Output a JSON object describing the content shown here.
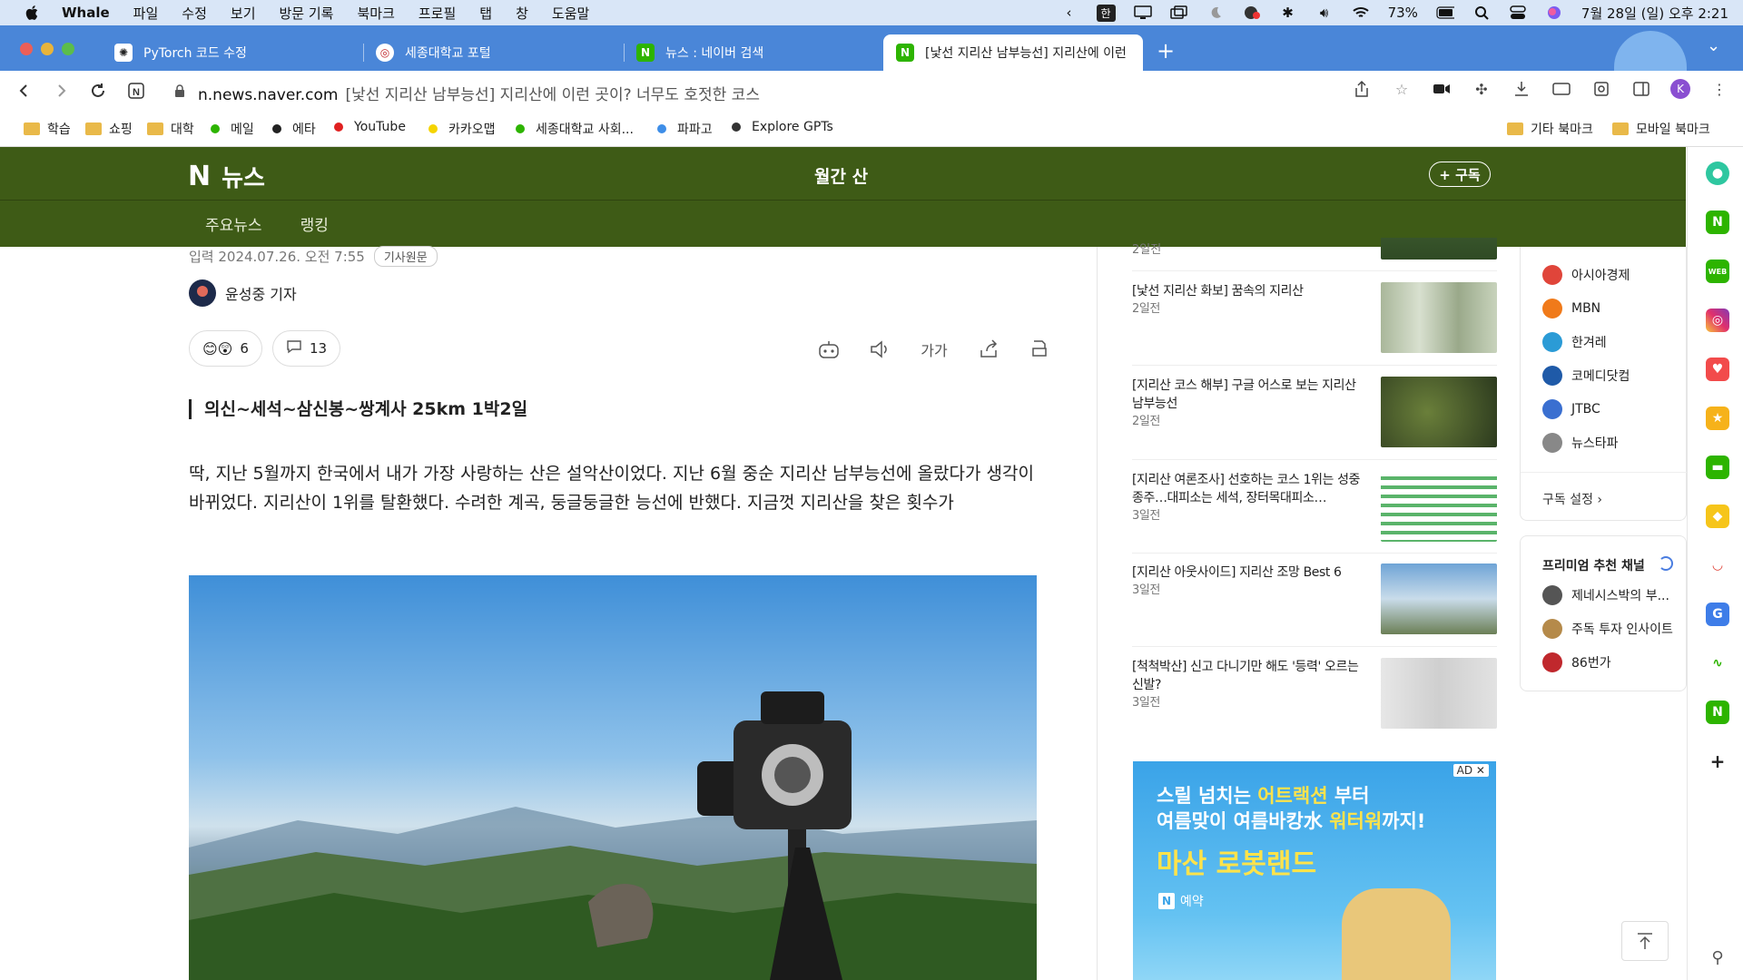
{
  "menubar": {
    "app_name": "Whale",
    "items": [
      "파일",
      "수정",
      "보기",
      "방문 기록",
      "북마크",
      "프로필",
      "탭",
      "창",
      "도움말"
    ],
    "ime": "한",
    "battery": "73%",
    "datetime": "7월 28일 (일) 오후 2:21"
  },
  "tabs": [
    {
      "label": "PyTorch 코드 수정",
      "icon": "openai-icon"
    },
    {
      "label": "세종대학교 포털",
      "icon": "sejong-icon"
    },
    {
      "label": "뉴스 : 네이버 검색",
      "icon": "naver-icon"
    },
    {
      "label": "[낯선 지리산 남부능선] 지리산에 이런",
      "icon": "naver-icon",
      "active": true
    }
  ],
  "address": {
    "host": "n.news.naver.com",
    "page_title": "[낯선 지리산 남부능선] 지리산에 이런 곳이? 너무도 호젓한 코스",
    "profile_initial": "K"
  },
  "bookmarks": {
    "left": [
      {
        "label": "학습",
        "type": "folder"
      },
      {
        "label": "쇼핑",
        "type": "folder"
      },
      {
        "label": "대학",
        "type": "folder"
      },
      {
        "label": "메일",
        "type": "dot",
        "color": "#2db400"
      },
      {
        "label": "에타",
        "type": "dot",
        "color": "#222222"
      },
      {
        "label": "YouTube",
        "type": "dot",
        "color": "#e02020"
      },
      {
        "label": "카카오맵",
        "type": "dot",
        "color": "#f5d400"
      },
      {
        "label": "세종대학교 사회...",
        "type": "dot",
        "color": "#2db400"
      },
      {
        "label": "파파고",
        "type": "dot",
        "color": "#3e8ee8"
      },
      {
        "label": "Explore GPTs",
        "type": "dot",
        "color": "#333333"
      }
    ],
    "right": [
      {
        "label": "기타 북마크"
      },
      {
        "label": "모바일 북마크"
      }
    ]
  },
  "naver": {
    "logo_text": "뉴스",
    "channel_title": "월간 산",
    "subscribe_label": "+ 구독",
    "nav": [
      "주요뉴스",
      "랭킹"
    ],
    "header_color": "#3e5b16"
  },
  "article": {
    "input_date": "입력 2024.07.26. 오전 7:55",
    "original_badge": "기사원문",
    "author": "윤성중 기자",
    "reaction_count": "6",
    "comment_count": "13",
    "font_size_label": "가가",
    "subheading": "의신~세석~삼신봉~쌍계사 25km 1박2일",
    "body": "딱, 지난 5월까지 한국에서 내가 가장 사랑하는 산은 설악산이었다. 지난 6월 중순 지리산 남부능선에 올랐다가 생각이 바뀌었다. 지리산이 1위를 탈환했다. 수려한 계곡, 둥글둥글한 능선에 반했다. 지금껏 지리산을 찾은 횟수가"
  },
  "related_news": [
    {
      "title": "[낯선 지리산 화보] 꿈속의 지리산",
      "time": "2일전"
    },
    {
      "title": "[지리산 코스 해부] 구글 어스로 보는 지리산 남부능선",
      "time": "2일전"
    },
    {
      "title": "[지리산 여론조사] 선호하는 코스 1위는 성중종주…대피소는 세석, 장터목대피소…",
      "time": "3일전"
    },
    {
      "title": "[지리산 아웃사이드] 지리산 조망 Best 6",
      "time": "3일전"
    },
    {
      "title": "[척척박산] 신고 다니기만 해도 '등력' 오르는 신발?",
      "time": "3일전"
    }
  ],
  "related_partial_time": "2일전",
  "ad": {
    "badge": "AD ✕",
    "line1_a": "스릴 넘치는 ",
    "line1_hl": "어트랙션",
    "line1_b": " 부터",
    "line2_a": "여름맞이 여름바캉水 ",
    "line2_hl": "워터워",
    "line2_b": "까지!",
    "line3": "마산 로봇랜드",
    "brand": "예약"
  },
  "press": {
    "items": [
      {
        "name": "아시아경제",
        "color": "#e0453a"
      },
      {
        "name": "MBN",
        "color": "#f07a1a"
      },
      {
        "name": "한겨레",
        "color": "#2b9bd6"
      },
      {
        "name": "코메디닷컴",
        "color": "#1f5aa8"
      },
      {
        "name": "JTBC",
        "color": "#3a6fd0"
      },
      {
        "name": "뉴스타파",
        "color": "#888888"
      }
    ],
    "setting_label": "구독 설정 ›"
  },
  "premium": {
    "title": "프리미엄 추천 채널",
    "items": [
      {
        "name": "제네시스박의 부...",
        "color": "#555555"
      },
      {
        "name": "주독 투자 인사이트",
        "color": "#b58a4a"
      },
      {
        "name": "86번가",
        "color": "#c0282d"
      }
    ]
  }
}
